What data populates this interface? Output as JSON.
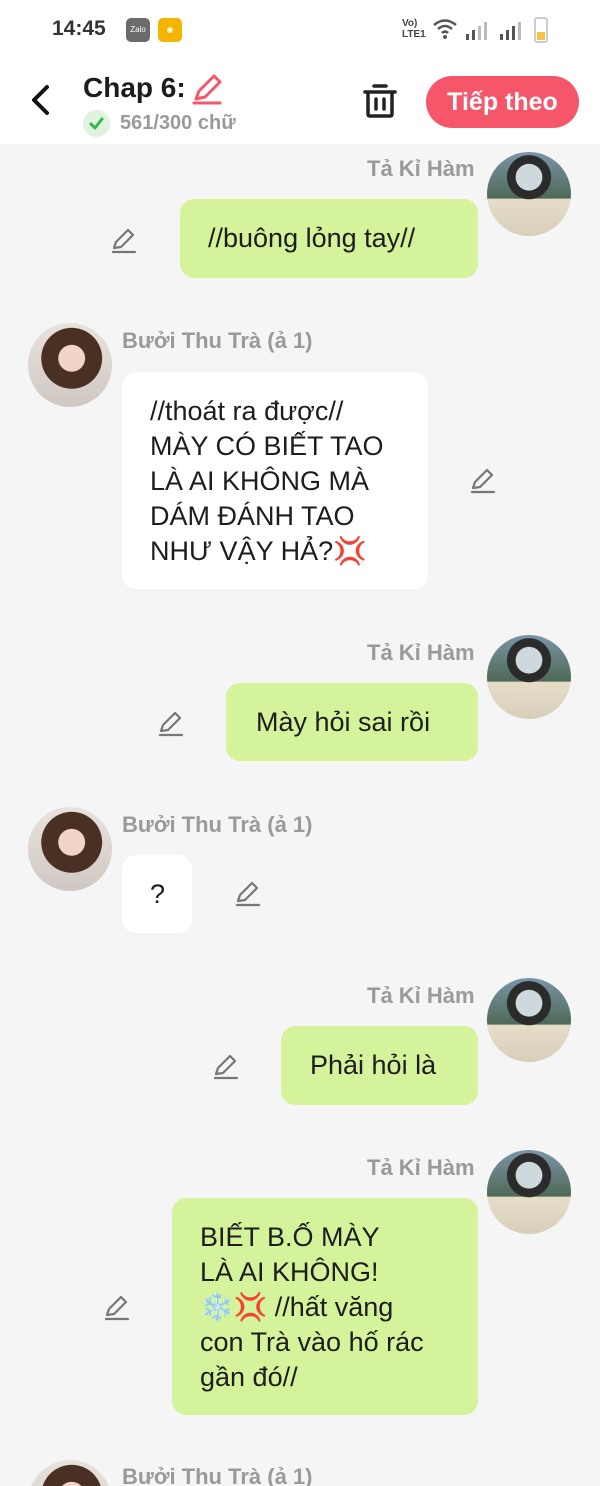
{
  "status_bar": {
    "time": "14:45",
    "apps": [
      "zalo-icon",
      "weibo-icon"
    ],
    "network_label": "VoLTE1"
  },
  "header": {
    "chapter_title": "Chap 6:",
    "word_count": "561/300 chữ",
    "next_button": "Tiếp theo",
    "accent_color": "#f6566a"
  },
  "messages": [
    {
      "sender": "Tả Kỉ Hàm",
      "side": "right",
      "text": "//buông lỏng tay//"
    },
    {
      "sender": "Bưởi Thu Trà (ả 1)",
      "side": "left",
      "text": "//thoát ra được//\nMÀY CÓ BIẾT TAO\nLÀ AI KHÔNG MÀ\nDÁM ĐÁNH TAO\nNHƯ VẬY HẢ?💢"
    },
    {
      "sender": "Tả Kỉ Hàm",
      "side": "right",
      "text": "Mày hỏi sai rồi"
    },
    {
      "sender": "Bưởi Thu Trà (ả 1)",
      "side": "left",
      "text": "?"
    },
    {
      "sender": "Tả Kỉ Hàm",
      "side": "right",
      "text": "Phải hỏi là"
    },
    {
      "sender": "Tả Kỉ Hàm",
      "side": "right",
      "text": "BIẾT B.Ố MÀY\nLÀ AI KHÔNG!\n❄️💢 //hất văng\ncon Trà vào hố rác\ngần đó//"
    },
    {
      "sender": "Bưởi Thu Trà (ả 1)",
      "side": "left",
      "text": ""
    }
  ],
  "colors": {
    "bubble_right": "#d5f39a",
    "bubble_left": "#ffffff",
    "background": "#f5f5f5"
  }
}
